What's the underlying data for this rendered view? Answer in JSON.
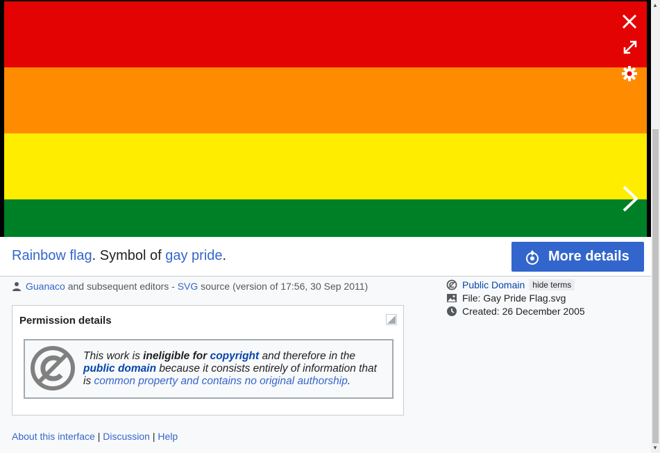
{
  "controls": {
    "close_label": "Close",
    "fullscreen_label": "Fullscreen",
    "settings_label": "Settings",
    "next_label": "Next image"
  },
  "caption": {
    "link1": "Rainbow flag",
    "text1": ". Symbol of ",
    "link2": "gay pride",
    "text2": "."
  },
  "more_details_label": "More details",
  "author_line": {
    "author": "Guanaco",
    "text1": " and subsequent editors - ",
    "source_link": "SVG",
    "text2": " source (version of 17:56, 30 Sep 2011)"
  },
  "permission": {
    "title": "Permission details",
    "t1": "This work is ",
    "b1": "ineligible for ",
    "l1": "copyright",
    "t2": " and therefore in the",
    "l2": "public domain",
    "t3": " because it consists entirely of information that",
    "t4": "is ",
    "l3": "common property and contains no original authorship",
    "t5": "."
  },
  "license": {
    "name": "Public Domain",
    "hide_terms": "hide terms"
  },
  "file_name": "File: Gay Pride Flag.svg",
  "created": "Created: 26 December 2005",
  "footer": {
    "about": "About this interface",
    "sep1": " | ",
    "discussion": "Discussion",
    "sep2": " | ",
    "help": "Help"
  },
  "colors": {
    "red": "#e40303",
    "orange": "#ff8c00",
    "yellow": "#ffed00",
    "green": "#008026",
    "accent": "#3366cc"
  }
}
